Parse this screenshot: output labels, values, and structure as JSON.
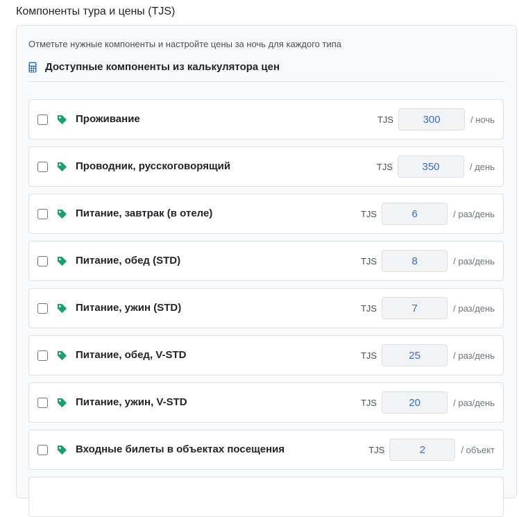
{
  "section_title": "Компоненты тура и цены (TJS)",
  "hint": "Отметьте нужные компоненты и настройте цены за ночь для каждого типа",
  "subheading": "Доступные компоненты из калькулятора цен",
  "colors": {
    "price_text": "#2f6fd6",
    "tag_icon": "#16a36e",
    "calc_icon": "#2f6fd6"
  },
  "items": [
    {
      "name": "Проживание",
      "currency": "TJS",
      "price": "300",
      "unit": "/ ночь",
      "checked": false
    },
    {
      "name": "Проводник, русскоговорящий",
      "currency": "TJS",
      "price": "350",
      "unit": "/ день",
      "checked": false
    },
    {
      "name": "Питание, завтрак (в отеле)",
      "currency": "TJS",
      "price": "6",
      "unit": "/ раз/день",
      "checked": false
    },
    {
      "name": "Питание, обед (STD)",
      "currency": "TJS",
      "price": "8",
      "unit": "/ раз/день",
      "checked": false
    },
    {
      "name": "Питание, ужин (STD)",
      "currency": "TJS",
      "price": "7",
      "unit": "/ раз/день",
      "checked": false
    },
    {
      "name": "Питание, обед, V-STD",
      "currency": "TJS",
      "price": "25",
      "unit": "/ раз/день",
      "checked": false
    },
    {
      "name": "Питание, ужин, V-STD",
      "currency": "TJS",
      "price": "20",
      "unit": "/ раз/день",
      "checked": false
    },
    {
      "name": "Входные билеты в объектах посещения",
      "currency": "TJS",
      "price": "2",
      "unit": "/ объект",
      "checked": false
    }
  ]
}
